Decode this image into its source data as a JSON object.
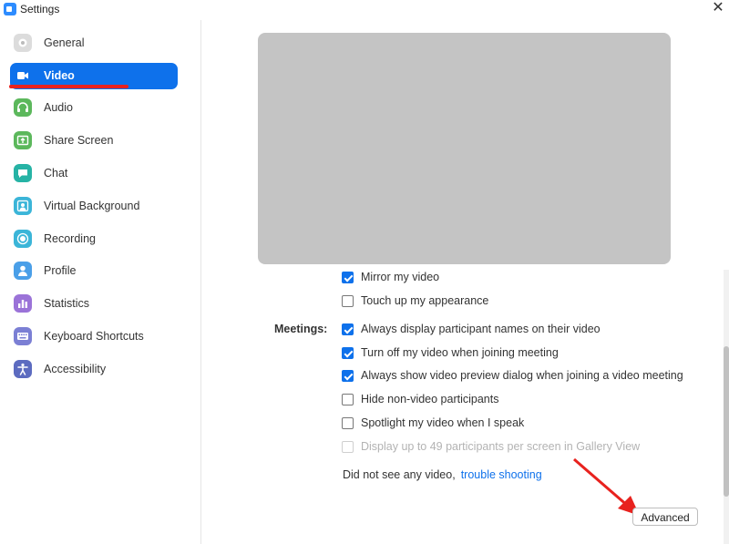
{
  "window": {
    "title": "Settings"
  },
  "sidebar": {
    "items": [
      {
        "label": "General",
        "icon": "gear-icon",
        "color": "#dcdcdc",
        "active": false
      },
      {
        "label": "Video",
        "icon": "video-camera-icon",
        "color": "#0e71eb",
        "active": true
      },
      {
        "label": "Audio",
        "icon": "headphones-icon",
        "color": "#5cb85c",
        "active": false
      },
      {
        "label": "Share Screen",
        "icon": "share-screen-icon",
        "color": "#5cb85c",
        "active": false
      },
      {
        "label": "Chat",
        "icon": "chat-bubble-icon",
        "color": "#26b3a5",
        "active": false
      },
      {
        "label": "Virtual Background",
        "icon": "person-background-icon",
        "color": "#3bb5d8",
        "active": false
      },
      {
        "label": "Recording",
        "icon": "record-icon",
        "color": "#3bb5d8",
        "active": false
      },
      {
        "label": "Profile",
        "icon": "person-icon",
        "color": "#4a9fe8",
        "active": false
      },
      {
        "label": "Statistics",
        "icon": "bar-chart-icon",
        "color": "#9b73d8",
        "active": false
      },
      {
        "label": "Keyboard Shortcuts",
        "icon": "keyboard-icon",
        "color": "#7b7fd4",
        "active": false
      },
      {
        "label": "Accessibility",
        "icon": "accessibility-icon",
        "color": "#5c6bc0",
        "active": false
      }
    ]
  },
  "main": {
    "options_top": [
      {
        "label": "Mirror my video",
        "checked": true
      },
      {
        "label": "Touch up my appearance",
        "checked": false
      }
    ],
    "meetings_label": "Meetings:",
    "meeting_options": [
      {
        "label": "Always display participant names on their video",
        "checked": true,
        "disabled": false
      },
      {
        "label": "Turn off my video when joining meeting",
        "checked": true,
        "disabled": false
      },
      {
        "label": "Always show video preview dialog when joining a video meeting",
        "checked": true,
        "disabled": false
      },
      {
        "label": "Hide non-video participants",
        "checked": false,
        "disabled": false
      },
      {
        "label": "Spotlight my video when I speak",
        "checked": false,
        "disabled": false
      },
      {
        "label": "Display up to 49 participants per screen in Gallery View",
        "checked": false,
        "disabled": true
      }
    ],
    "help_text": "Did not see any video,",
    "help_link": "trouble shooting",
    "advanced_button": "Advanced"
  },
  "colors": {
    "accent": "#0e71eb",
    "annotation": "#e8221e"
  }
}
